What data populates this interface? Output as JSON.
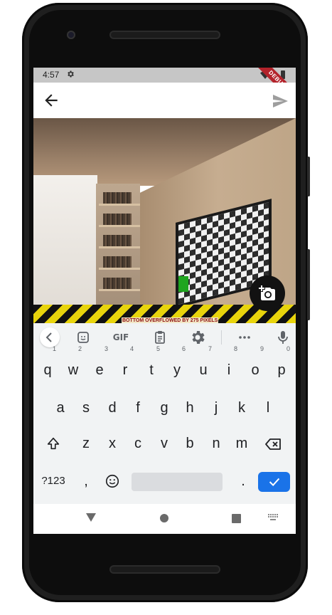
{
  "statusbar": {
    "time": "4:57",
    "icons": [
      "gear-icon",
      "wifi-icon",
      "battery-icon"
    ]
  },
  "debug_banner": "DEBUG",
  "appbar": {
    "back_icon": "arrow-back-icon",
    "send_icon": "send-icon"
  },
  "fab": {
    "icon": "add-a-photo-icon"
  },
  "overflow_warning": "BOTTOM OVERFLOWED BY 275 PIXELS",
  "keyboard": {
    "toolbar": {
      "gif_label": "GIF",
      "items": [
        "back-chevron-icon",
        "sticker-icon",
        "gif",
        "clipboard-icon",
        "settings-icon",
        "more-icon",
        "mic-icon"
      ]
    },
    "row1": [
      {
        "key": "q",
        "hint": "1"
      },
      {
        "key": "w",
        "hint": "2"
      },
      {
        "key": "e",
        "hint": "3"
      },
      {
        "key": "r",
        "hint": "4"
      },
      {
        "key": "t",
        "hint": "5"
      },
      {
        "key": "y",
        "hint": "6"
      },
      {
        "key": "u",
        "hint": "7"
      },
      {
        "key": "i",
        "hint": "8"
      },
      {
        "key": "o",
        "hint": "9"
      },
      {
        "key": "p",
        "hint": "0"
      }
    ],
    "row2": [
      "a",
      "s",
      "d",
      "f",
      "g",
      "h",
      "j",
      "k",
      "l"
    ],
    "row3": [
      "z",
      "x",
      "c",
      "v",
      "b",
      "n",
      "m"
    ],
    "row4": {
      "symbols": "?123",
      "comma": ",",
      "period": "."
    }
  },
  "colors": {
    "accent": "#1a73e8",
    "keyboard_bg": "#f1f3f4",
    "statusbar_bg": "#c6c6c6"
  }
}
